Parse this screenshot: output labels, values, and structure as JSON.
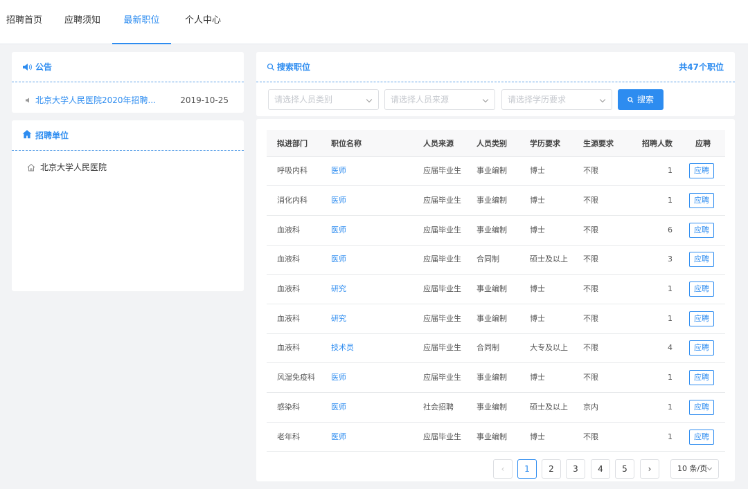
{
  "nav": {
    "tabs": [
      "招聘首页",
      "应聘须知",
      "最新职位",
      "个人中心"
    ],
    "active": 2
  },
  "notice": {
    "title": "公告",
    "item_title": "北京大学人民医院2020年招聘...",
    "item_date": "2019-10-25"
  },
  "units": {
    "title": "招聘单位",
    "items": [
      "北京大学人民医院"
    ]
  },
  "search": {
    "title": "搜索职位",
    "count_text": "共47个职位",
    "filter_type": "请选择人员类别",
    "filter_source": "请选择人员来源",
    "filter_edu": "请选择学历要求",
    "button": "搜索"
  },
  "table": {
    "headers": [
      "拟进部门",
      "职位名称",
      "人员来源",
      "人员类别",
      "学历要求",
      "生源要求",
      "招聘人数",
      "应聘"
    ],
    "apply_label": "应聘",
    "rows": [
      [
        "呼吸内科",
        "医师",
        "应届毕业生",
        "事业编制",
        "博士",
        "不限",
        "1"
      ],
      [
        "消化内科",
        "医师",
        "应届毕业生",
        "事业编制",
        "博士",
        "不限",
        "1"
      ],
      [
        "血液科",
        "医师",
        "应届毕业生",
        "事业编制",
        "博士",
        "不限",
        "6"
      ],
      [
        "血液科",
        "医师",
        "应届毕业生",
        "合同制",
        "硕士及以上",
        "不限",
        "3"
      ],
      [
        "血液科",
        "研究",
        "应届毕业生",
        "事业编制",
        "博士",
        "不限",
        "1"
      ],
      [
        "血液科",
        "研究",
        "应届毕业生",
        "事业编制",
        "博士",
        "不限",
        "1"
      ],
      [
        "血液科",
        "技术员",
        "应届毕业生",
        "合同制",
        "大专及以上",
        "不限",
        "4"
      ],
      [
        "风湿免疫科",
        "医师",
        "应届毕业生",
        "事业编制",
        "博士",
        "不限",
        "1"
      ],
      [
        "感染科",
        "医师",
        "社会招聘",
        "事业编制",
        "硕士及以上",
        "京内",
        "1"
      ],
      [
        "老年科",
        "医师",
        "应届毕业生",
        "事业编制",
        "博士",
        "不限",
        "1"
      ]
    ]
  },
  "pagination": {
    "prev": "‹",
    "pages": [
      "1",
      "2",
      "3",
      "4",
      "5"
    ],
    "current": "1",
    "next": "›",
    "page_size": "10 条/页"
  },
  "colors": {
    "accent": "#2d8cf0",
    "background": "#f2f3f5"
  }
}
